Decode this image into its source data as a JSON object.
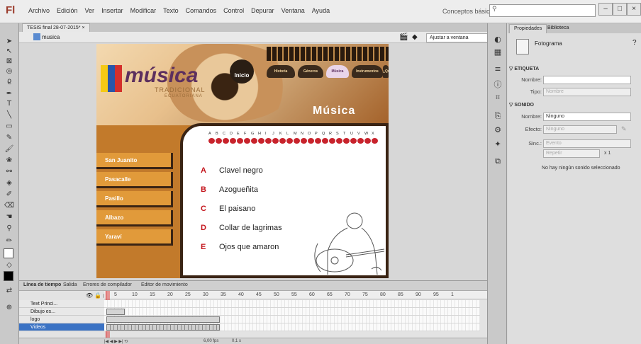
{
  "app": {
    "logo": "Fl"
  },
  "menu": [
    "Archivo",
    "Edición",
    "Ver",
    "Insertar",
    "Modificar",
    "Texto",
    "Comandos",
    "Control",
    "Depurar",
    "Ventana",
    "Ayuda"
  ],
  "workspace": "Conceptos básicos",
  "window_buttons": [
    "–",
    "□",
    "×"
  ],
  "document_tab": {
    "label": "TESIS final 28-07-2015*",
    "close": "×"
  },
  "scene": {
    "name": "musica",
    "zoom": "Ajustar a ventana"
  },
  "stage": {
    "logo_title": "música",
    "logo_sub1": "TRADICIONAL",
    "logo_sub2": "ECUATORIANA",
    "home_label": "Inicio",
    "nav": [
      "Historia",
      "Géneros",
      "Música",
      "Instrumentos",
      "¿Quiénes somos?"
    ],
    "section_title": "Música",
    "letters": [
      "A",
      "B",
      "C",
      "D",
      "E",
      "F",
      "G",
      "H",
      "I",
      "J",
      "K",
      "L",
      "M",
      "N",
      "O",
      "P",
      "Q",
      "R",
      "S",
      "T",
      "U",
      "V",
      "W",
      "X"
    ],
    "genres": [
      "San Juanito",
      "Pasacalle",
      "Pasillo",
      "Albazo",
      "Yaraví"
    ],
    "songs": [
      {
        "letter": "A",
        "title": "Clavel negro"
      },
      {
        "letter": "B",
        "title": "Azogueñita"
      },
      {
        "letter": "C",
        "title": "El paisano"
      },
      {
        "letter": "D",
        "title": "Collar de lagrimas"
      },
      {
        "letter": "E",
        "title": "Ojos que amaron"
      }
    ]
  },
  "properties": {
    "tabs": [
      "Propiedades",
      "Biblioteca"
    ],
    "frame_label": "Fotograma",
    "section_label": "ETIQUETA",
    "name_label": "Nombre:",
    "type_label": "Tipo:",
    "type_value": "Nombre",
    "section_sound": "SONIDO",
    "sound_name_label": "Nombre:",
    "sound_name_value": "Ninguno",
    "effect_label": "Efecto:",
    "effect_value": "Ninguno",
    "sync_label": "Sinc.:",
    "sync_value": "Evento",
    "repeat_value": "Repetir",
    "repeat_count": "x 1",
    "no_sound": "No hay ningún sonido seleccionado"
  },
  "timeline": {
    "tabs": [
      "Línea de tiempo",
      "Salida",
      "Errores de compilador",
      "Editor de movimiento"
    ],
    "frame_numbers": [
      "5",
      "10",
      "15",
      "20",
      "25",
      "30",
      "35",
      "40",
      "45",
      "50",
      "55",
      "60",
      "65",
      "70",
      "75",
      "80",
      "85",
      "90",
      "95",
      "1"
    ],
    "layers": [
      "Text Princi...",
      "Dibujo es...",
      "logo",
      "Videos"
    ],
    "footer": {
      "fps": "6,00 fps",
      "time": "0,1 s"
    }
  }
}
